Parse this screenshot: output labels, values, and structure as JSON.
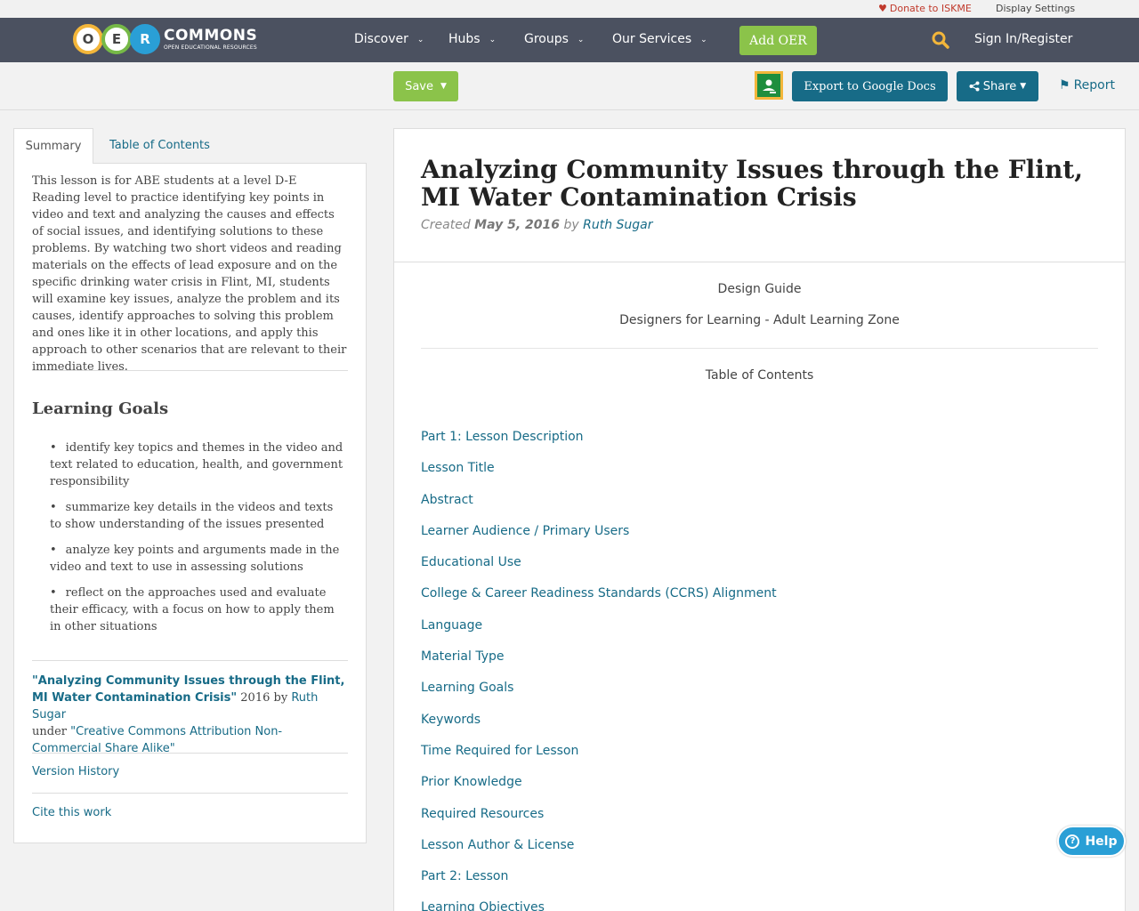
{
  "utility": {
    "donate": "Donate to ISKME",
    "display_settings": "Display Settings"
  },
  "logo": {
    "letters": [
      "O",
      "E",
      "R"
    ],
    "wordmark": "COMMONS",
    "tagline": "OPEN EDUCATIONAL RESOURCES"
  },
  "nav": {
    "items": [
      {
        "label": "Discover"
      },
      {
        "label": "Hubs"
      },
      {
        "label": "Groups"
      },
      {
        "label": "Our Services"
      }
    ],
    "add_oer": "Add OER",
    "sign_in": "Sign In/Register"
  },
  "actions": {
    "save": "Save",
    "export": "Export to Google Docs",
    "share": "Share",
    "report": "Report"
  },
  "sidebar": {
    "tabs": [
      "Summary",
      "Table of Contents"
    ],
    "summary": "This lesson is for ABE students at a level D-E Reading level to practice identifying key points in video and text and analyzing the causes and effects of social issues, and identifying solutions to these problems. By watching two short videos and reading materials on the effects of lead exposure and on the specific drinking water crisis in Flint, MI, students will examine key issues, analyze the problem and its causes, identify approaches to solving this problem and ones like it in other locations, and apply this approach to other scenarios that are relevant to their immediate lives.",
    "goals_heading": "Learning Goals",
    "goals": [
      "identify key topics and themes in the video and text related to education, health, and government responsibility",
      "summarize key details in the videos and texts to show understanding of the issues presented",
      "analyze key points and arguments made in the video and text to use in assessing solutions",
      "reflect on the approaches used and evaluate their efficacy, with a focus on how to apply them in other situations"
    ],
    "attribution": {
      "title": "\"Analyzing Community Issues through the Flint, MI Water Contamination Crisis\"",
      "year_by": " 2016 by ",
      "author": "Ruth Sugar",
      "under": "under ",
      "license": "\"Creative Commons Attribution Non-Commercial Share Alike\""
    },
    "version_history": "Version History",
    "cite": "Cite this work"
  },
  "resource": {
    "title": "Analyzing Community Issues through the Flint, MI Water Contamination Crisis",
    "created_label": "Created ",
    "date": "May 5, 2016",
    "by": " by ",
    "author": "Ruth Sugar",
    "design_guide": "Design Guide",
    "zone": "Designers for Learning - Adult Learning Zone",
    "toc_heading": "Table of Contents",
    "toc": [
      "Part 1: Lesson Description",
      "Lesson Title",
      "Abstract",
      "Learner Audience / Primary Users",
      "Educational Use",
      "College & Career Readiness Standards (CCRS) Alignment",
      "Language",
      "Material Type",
      "Learning Goals",
      "Keywords",
      "Time Required for Lesson",
      "Prior Knowledge",
      "Required Resources",
      "Lesson Author & License",
      "Part 2: Lesson",
      "Learning Objectives"
    ]
  },
  "help": "Help",
  "colors": {
    "nav_bg": "#4b5160",
    "green": "#8bc34a",
    "teal": "#176b87",
    "help_blue": "#2a9fd6"
  }
}
